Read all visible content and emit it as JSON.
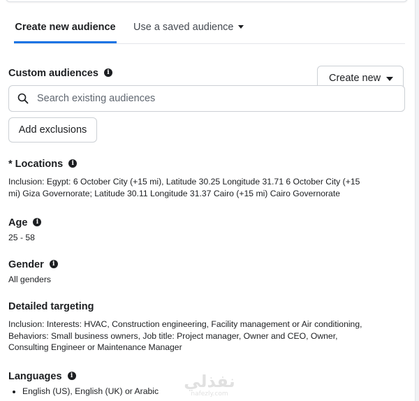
{
  "tabs": {
    "create_new_audience": "Create new audience",
    "use_saved_audience": "Use a saved audience"
  },
  "custom_audiences": {
    "title": "Custom audiences",
    "create_new_label": "Create new",
    "search_placeholder": "Search existing audiences",
    "add_exclusions_label": "Add exclusions"
  },
  "locations": {
    "title": "* Locations",
    "inclusion_label": "Inclusion:",
    "inclusion_text": "Egypt: 6 October City (+15 mi), Latitude 30.25 Longitude 31.71 6 October City (+15 mi) Giza Governorate; Latitude 30.11 Longitude 31.37 Cairo (+15 mi) Cairo Governorate"
  },
  "age": {
    "title": "Age",
    "value": "25 - 58"
  },
  "gender": {
    "title": "Gender",
    "value": "All genders"
  },
  "detailed_targeting": {
    "title": "Detailed targeting",
    "inclusion_label": "Inclusion:",
    "inclusion_text": "Interests: HVAC, Construction engineering, Facility management or Air conditioning, Behaviors: Small business owners, Job title: Project manager, Owner and CEO, Owner, Consulting Engineer or Maintenance Manager"
  },
  "languages": {
    "title": "Languages",
    "items": [
      "English (US), English (UK) or Arabic"
    ]
  },
  "watermark": {
    "logo_text": "نفذلي",
    "url": "nafezly.com"
  },
  "icons": {
    "info": "info-icon",
    "search": "search-icon",
    "caret": "caret-down-icon"
  },
  "colors": {
    "accent": "#1b74e4",
    "text": "#1c1e21",
    "border": "#ccd0d5"
  }
}
